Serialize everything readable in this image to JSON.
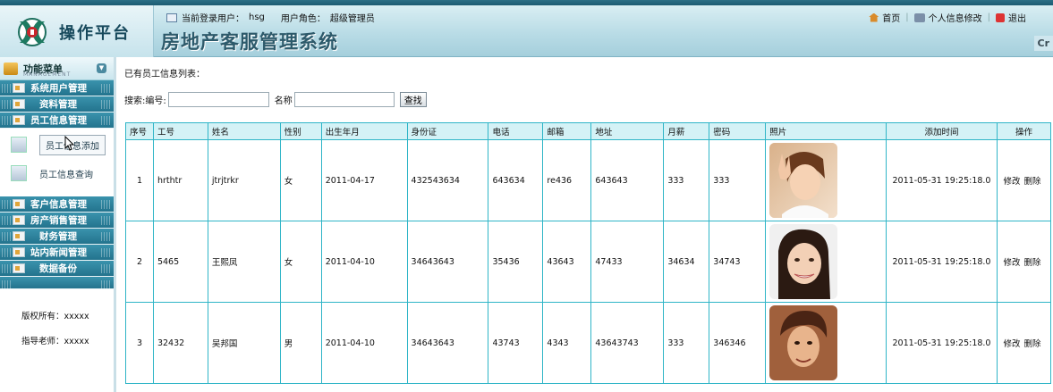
{
  "header": {
    "logo_text": "操作平台",
    "current_user_label": "当前登录用户：",
    "current_user": "hsg",
    "role_label": "用户角色：",
    "role": "超级管理员",
    "system_title": "房地产客服管理系统",
    "links": {
      "home": "首页",
      "profile_edit": "个人信息修改",
      "logout": "退出"
    },
    "right_edge_text": "Cr"
  },
  "sidebar": {
    "menu_title": "功能菜单",
    "menu_subtitle": "MANAGEMENT",
    "items": [
      {
        "label": "系统用户管理"
      },
      {
        "label": "资料管理"
      },
      {
        "label": "员工信息管理"
      }
    ],
    "sub_items": [
      {
        "label": "员工信息添加",
        "active": true
      },
      {
        "label": "员工信息查询",
        "active": false
      }
    ],
    "items_after": [
      {
        "label": "客户信息管理"
      },
      {
        "label": "房产销售管理"
      },
      {
        "label": "财务管理"
      },
      {
        "label": "站内新闻管理"
      },
      {
        "label": "数据备份"
      }
    ],
    "copyright": "版权所有：xxxxx",
    "teacher": "指导老师：xxxxx"
  },
  "main": {
    "list_title": "已有员工信息列表：",
    "search": {
      "label_id": "搜索:编号:",
      "label_name": "名称",
      "id_value": "",
      "name_value": "",
      "button": "查找"
    },
    "columns": [
      "序号",
      "工号",
      "姓名",
      "性别",
      "出生年月",
      "身份证",
      "电话",
      "邮箱",
      "地址",
      "月薪",
      "密码",
      "照片",
      "添加时间",
      "操作"
    ],
    "rows": [
      {
        "no": "1",
        "emp_id": "hrthtr",
        "name": "jtrjtrkr",
        "gender": "女",
        "birth": "2011-04-17",
        "id_card": "432543634",
        "phone": "643634",
        "email": "re436",
        "address": "643643",
        "salary": "333",
        "password": "333",
        "photo": "woman-peace-sign-photo",
        "added": "2011-05-31 19:25:18.0",
        "edit": "修改",
        "delete": "删除"
      },
      {
        "no": "2",
        "emp_id": "5465",
        "name": "王熙凤",
        "gender": "女",
        "birth": "2011-04-10",
        "id_card": "34643643",
        "phone": "35436",
        "email": "43643",
        "address": "47433",
        "salary": "34634",
        "password": "34743",
        "photo": "smiling-woman-photo",
        "added": "2011-05-31 19:25:18.0",
        "edit": "修改",
        "delete": "删除"
      },
      {
        "no": "3",
        "emp_id": "32432",
        "name": "吴邦国",
        "gender": "男",
        "birth": "2011-04-10",
        "id_card": "34643643",
        "phone": "43743",
        "email": "4343",
        "address": "43643743",
        "salary": "333",
        "password": "346346",
        "photo": "young-man-photo",
        "added": "2011-05-31 19:25:18.0",
        "edit": "修改",
        "delete": "删除"
      }
    ]
  },
  "colors": {
    "header_bg": "#b9dce6",
    "menu_item_bg": "#2b82a0",
    "table_border": "#2fb5c7",
    "table_header_bg": "#d4f2f6"
  }
}
